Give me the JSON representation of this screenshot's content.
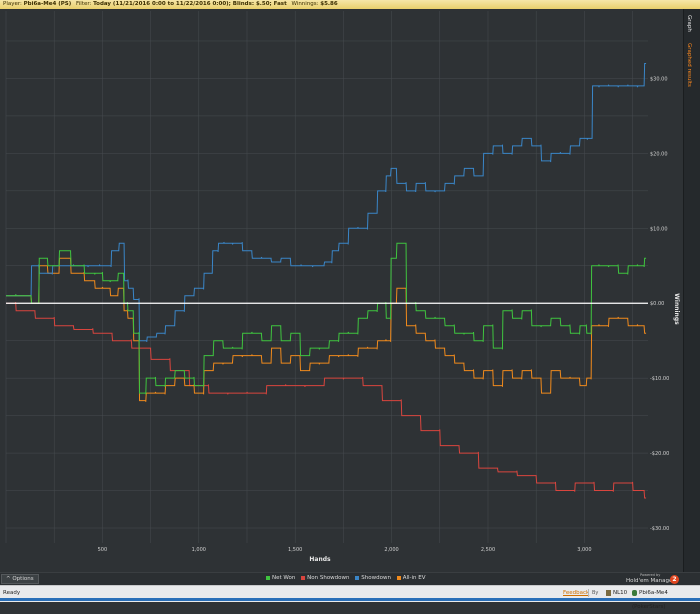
{
  "filter_bar": {
    "player_label": "Player:",
    "player_value": "Pbi6a-Me4 (PS)",
    "filter_label": "Filter:",
    "filter_value": "Today (11/21/2016 0:00 to 11/22/2016 0:00); Blinds: $.50; Fast",
    "winnings_label": "Winnings:",
    "winnings_value": "$5.86"
  },
  "side_tabs": {
    "graph": "Graph",
    "graphed_results": "Graphed results"
  },
  "legend": {
    "items": [
      {
        "label": "Net Won",
        "color": "#3fc43f"
      },
      {
        "label": "Non Showdown",
        "color": "#d9453e"
      },
      {
        "label": "Showdown",
        "color": "#3a86c8"
      },
      {
        "label": "All-in EV",
        "color": "#f08a1c"
      }
    ]
  },
  "options_label": "^ Options",
  "branding": {
    "powered_by": "Powered by",
    "name": "Hold'em Manager",
    "logo_text": "2"
  },
  "status": {
    "ready": "Ready",
    "feedback": "Feedback",
    "by": "By",
    "stake": "NL10",
    "player": "Pbi6a-Me4 (PokerStars)"
  },
  "chart_data": {
    "type": "line",
    "xlabel": "Hands",
    "ylabel": "Winnings",
    "xlim": [
      0,
      3330
    ],
    "ylim": [
      -32,
      39
    ],
    "x_ticks": [
      {
        "v": 500,
        "label": "500"
      },
      {
        "v": 1000,
        "label": "1,000"
      },
      {
        "v": 1500,
        "label": "1,500"
      },
      {
        "v": 2000,
        "label": "2,000"
      },
      {
        "v": 2500,
        "label": "2,500"
      },
      {
        "v": 3000,
        "label": "3,000"
      }
    ],
    "y_ticks": [
      {
        "v": 30,
        "label": "$30.00"
      },
      {
        "v": 20,
        "label": "$20.00"
      },
      {
        "v": 10,
        "label": "$10.00"
      },
      {
        "v": 0,
        "label": "$0.00"
      },
      {
        "v": -10,
        "label": "-$10.00"
      },
      {
        "v": -20,
        "label": "-$20.00"
      },
      {
        "v": -30,
        "label": "-$30.00"
      }
    ],
    "grid": true,
    "legend_position": "bottom",
    "series": [
      {
        "name": "Showdown",
        "color": "#3a86c8",
        "x": [
          0,
          100,
          160,
          180,
          300,
          400,
          450,
          520,
          570,
          600,
          625,
          640,
          680,
          700,
          760,
          800,
          850,
          900,
          950,
          1000,
          1050,
          1090,
          1110,
          1150,
          1200,
          1250,
          1300,
          1350,
          1400,
          1450,
          1500,
          1560,
          1620,
          1680,
          1700,
          1750,
          1800,
          1850,
          1900,
          1950,
          1990,
          2000,
          2050,
          2100,
          2150,
          2200,
          2250,
          2300,
          2350,
          2400,
          2450,
          2500,
          2550,
          2600,
          2650,
          2700,
          2750,
          2800,
          2850,
          2900,
          2950,
          3000,
          3030,
          3050,
          3100,
          3150,
          3200,
          3250,
          3300,
          3320
        ],
        "y": [
          1,
          1,
          5,
          4,
          5,
          5,
          5,
          5,
          7,
          8,
          3,
          2,
          0.5,
          -5,
          -4.5,
          -4,
          -3,
          -1,
          1,
          2,
          4,
          7,
          8,
          8,
          8,
          7,
          6,
          6,
          5.5,
          6,
          5,
          5,
          5,
          5.5,
          7,
          8,
          10,
          10,
          12,
          15,
          17,
          18,
          16,
          15,
          16,
          15,
          15,
          16,
          17,
          18,
          17,
          20,
          21,
          20,
          21,
          22,
          21,
          19,
          20,
          20,
          21,
          22,
          22,
          29,
          29,
          29,
          29,
          29,
          29,
          32
        ]
      },
      {
        "name": "Net Won",
        "color": "#3fc43f",
        "x": [
          0,
          100,
          160,
          180,
          250,
          300,
          370,
          440,
          480,
          520,
          560,
          600,
          620,
          640,
          680,
          700,
          750,
          800,
          850,
          900,
          950,
          1000,
          1050,
          1100,
          1150,
          1200,
          1250,
          1300,
          1350,
          1400,
          1450,
          1500,
          1550,
          1600,
          1650,
          1700,
          1750,
          1800,
          1850,
          1900,
          1950,
          1990,
          2000,
          2050,
          2100,
          2150,
          2200,
          2250,
          2300,
          2350,
          2400,
          2450,
          2500,
          2550,
          2600,
          2650,
          2700,
          2750,
          2800,
          2850,
          2900,
          2950,
          3000,
          3020,
          3050,
          3100,
          3150,
          3200,
          3250,
          3300,
          3320
        ],
        "y": [
          1,
          1,
          0,
          6,
          5,
          7,
          5,
          4,
          4,
          3,
          3,
          4,
          0,
          -1,
          -4,
          -12,
          -10,
          -11,
          -10,
          -9,
          -10,
          -11,
          -7,
          -5,
          -6,
          -6,
          -4,
          -4,
          -5,
          -3,
          -5,
          -4,
          -7,
          -6,
          -6,
          -5,
          -4,
          -4,
          -2,
          -1,
          0,
          -2,
          6,
          8,
          0,
          -1,
          -2,
          -2,
          -3,
          -4,
          -4,
          -5,
          -3,
          -6,
          -1,
          -2,
          -1,
          -3,
          -3,
          -2,
          -3,
          -4,
          -3,
          -4,
          5,
          5,
          5,
          4,
          5,
          5,
          6
        ]
      },
      {
        "name": "All-in EV",
        "color": "#f08a1c",
        "x": [
          0,
          100,
          160,
          180,
          250,
          300,
          370,
          440,
          480,
          520,
          560,
          600,
          620,
          640,
          680,
          700,
          750,
          800,
          850,
          900,
          950,
          1000,
          1050,
          1100,
          1150,
          1200,
          1250,
          1300,
          1350,
          1400,
          1450,
          1500,
          1550,
          1600,
          1650,
          1700,
          1750,
          1800,
          1850,
          1900,
          1950,
          1990,
          2000,
          2050,
          2100,
          2150,
          2200,
          2250,
          2300,
          2350,
          2400,
          2450,
          2500,
          2550,
          2600,
          2650,
          2700,
          2750,
          2800,
          2850,
          2900,
          2950,
          3000,
          3020,
          3050,
          3100,
          3150,
          3200,
          3250,
          3300,
          3320
        ],
        "y": [
          1,
          1,
          0,
          5,
          4,
          6,
          4,
          3,
          2,
          2,
          1,
          2,
          -1,
          -2,
          -5,
          -13,
          -12,
          -12,
          -11,
          -10,
          -11,
          -12,
          -9,
          -8,
          -8,
          -7,
          -7,
          -7,
          -8,
          -6,
          -8,
          -7,
          -9,
          -8,
          -8,
          -7,
          -7,
          -7,
          -6,
          -6,
          -5,
          -5,
          0,
          2,
          -3,
          -4,
          -5,
          -6,
          -7,
          -8,
          -9,
          -10,
          -9,
          -11,
          -9,
          -10,
          -9,
          -10,
          -12,
          -9,
          -10,
          -10,
          -11,
          -10,
          -3,
          -3,
          -2,
          -2,
          -3,
          -3,
          -4
        ]
      },
      {
        "name": "Non Showdown",
        "color": "#d9453e",
        "x": [
          0,
          100,
          200,
          300,
          400,
          500,
          600,
          700,
          800,
          900,
          1000,
          1100,
          1200,
          1300,
          1400,
          1500,
          1600,
          1700,
          1800,
          1900,
          2000,
          2100,
          2200,
          2300,
          2400,
          2500,
          2600,
          2700,
          2800,
          2900,
          3000,
          3100,
          3200,
          3300,
          3320
        ],
        "y": [
          0,
          -1,
          -2,
          -3,
          -3.5,
          -4,
          -5,
          -6,
          -7.5,
          -9,
          -11,
          -12,
          -12,
          -12,
          -11,
          -11,
          -11,
          -10,
          -10,
          -11,
          -13,
          -15,
          -17,
          -19,
          -20,
          -22,
          -22.5,
          -23,
          -24,
          -25,
          -24,
          -25,
          -24,
          -25,
          -26
        ]
      }
    ]
  }
}
